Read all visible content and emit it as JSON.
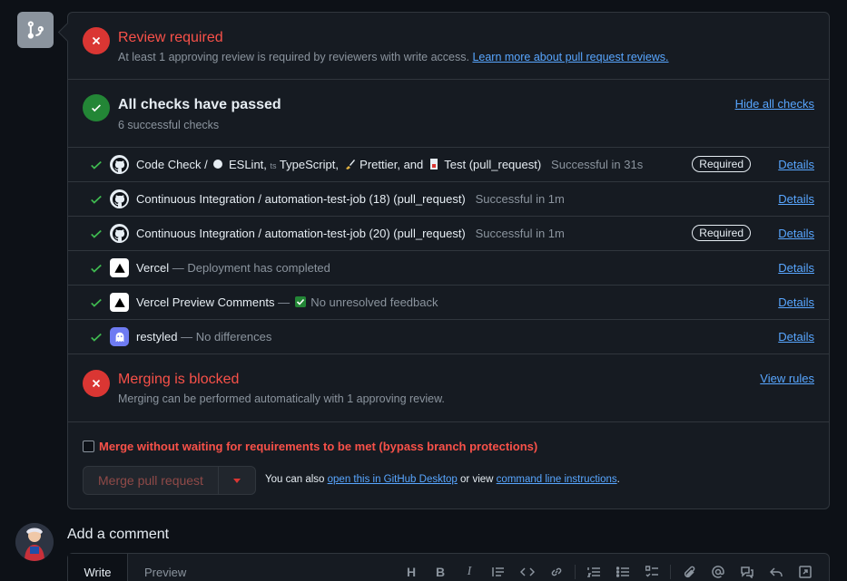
{
  "review": {
    "title": "Review required",
    "text": "At least 1 approving review is required by reviewers with write access. ",
    "link": "Learn more about pull request reviews."
  },
  "checks_summary": {
    "title": "All checks have passed",
    "subtitle": "6 successful checks",
    "toggle": "Hide all checks"
  },
  "checks": [
    {
      "name_parts": [
        "Code Check / ",
        " ESLint, ",
        " TypeScript, ",
        " Prettier, and ",
        " Test (pull_request)"
      ],
      "status": "Successful in 31s",
      "required": "Required",
      "details": "Details",
      "avatar": "github-icon"
    },
    {
      "name": "Continuous Integration / automation-test-job (18) (pull_request)",
      "status": "Successful in 1m",
      "details": "Details",
      "avatar": "github-icon"
    },
    {
      "name": "Continuous Integration / automation-test-job (20) (pull_request)",
      "status": "Successful in 1m",
      "required": "Required",
      "details": "Details",
      "avatar": "github-icon"
    },
    {
      "name": "Vercel",
      "status": " — Deployment has completed",
      "details": "Details",
      "avatar": "vercel-icon"
    },
    {
      "name": "Vercel Preview Comments",
      "status_pre": " — ",
      "status": " No unresolved feedback",
      "details": "Details",
      "avatar": "vercel-icon"
    },
    {
      "name": "restyled",
      "status": " — No differences",
      "details": "Details",
      "avatar": "restyled-icon"
    }
  ],
  "merging": {
    "title": "Merging is blocked",
    "subtitle": "Merging can be performed automatically with 1 approving review.",
    "link": "View rules"
  },
  "bypass": {
    "label": "Merge without waiting for requirements to be met (bypass branch protections)"
  },
  "merge_button": {
    "label": "Merge pull request"
  },
  "also": {
    "pre": "You can also ",
    "link1": "open this in GitHub Desktop",
    "mid": " or view ",
    "link2": "command line instructions",
    "post": "."
  },
  "comment": {
    "heading": "Add a comment",
    "tab_write": "Write",
    "tab_preview": "Preview",
    "toolbar": [
      "H",
      "B",
      "I",
      "quote-icon",
      "code-icon",
      "link-icon",
      "ordered-list-icon",
      "unordered-list-icon",
      "task-list-icon",
      "attach-icon",
      "mention-icon",
      "reference-icon",
      "undo-icon",
      "fullscreen-icon"
    ]
  },
  "colors": {
    "danger": "#da3633",
    "success": "#238636",
    "link": "#58a6ff",
    "bg": "#0d1117",
    "panel": "#161b22",
    "border": "#30363d"
  }
}
